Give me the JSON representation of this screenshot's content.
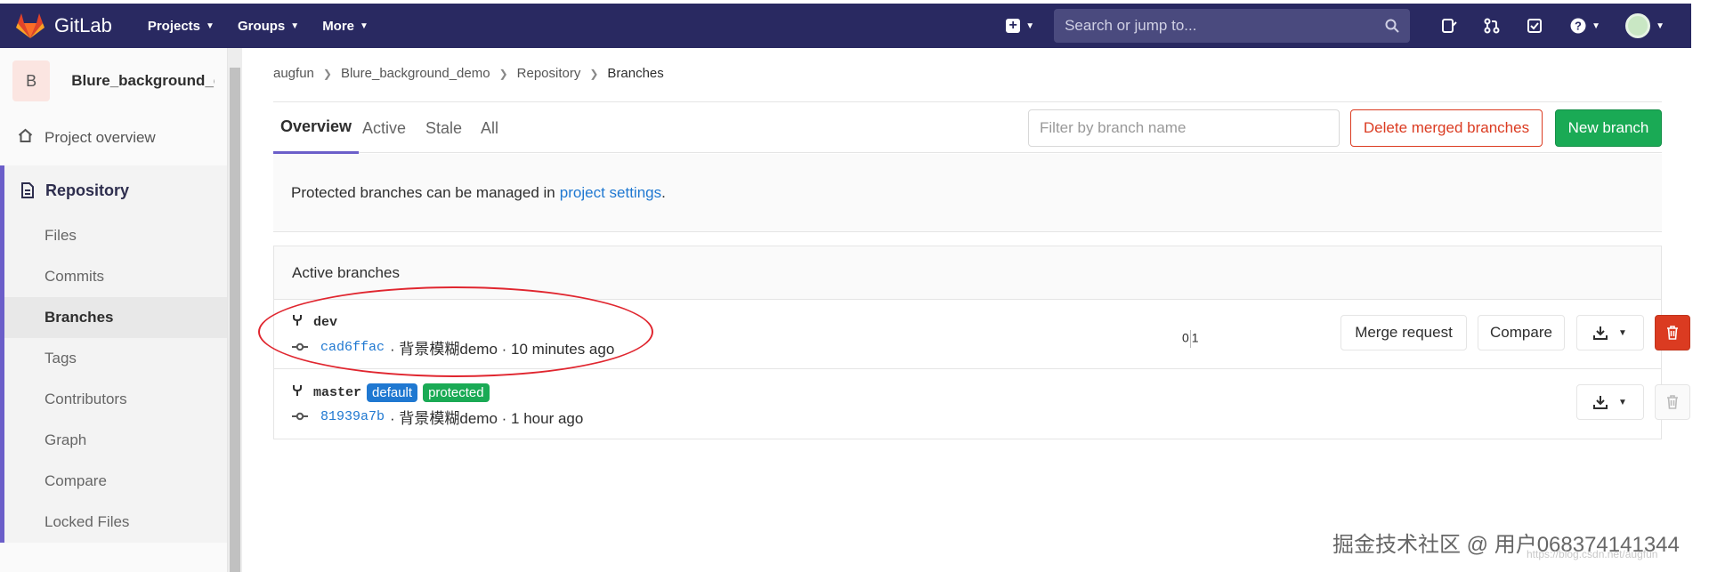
{
  "nav": {
    "brand": "GitLab",
    "links": [
      {
        "label": "Projects"
      },
      {
        "label": "Groups"
      },
      {
        "label": "More"
      }
    ],
    "search_placeholder": "Search or jump to..."
  },
  "sidebar": {
    "project_avatar_letter": "B",
    "project_name": "Blure_background_d...",
    "overview_label": "Project overview",
    "repository_label": "Repository",
    "sub_items": [
      {
        "label": "Files"
      },
      {
        "label": "Commits"
      },
      {
        "label": "Branches"
      },
      {
        "label": "Tags"
      },
      {
        "label": "Contributors"
      },
      {
        "label": "Graph"
      },
      {
        "label": "Compare"
      },
      {
        "label": "Locked Files"
      }
    ]
  },
  "breadcrumb": [
    "augfun",
    "Blure_background_demo",
    "Repository",
    "Branches"
  ],
  "tabs": [
    {
      "label": "Overview"
    },
    {
      "label": "Active"
    },
    {
      "label": "Stale"
    },
    {
      "label": "All"
    }
  ],
  "filter_placeholder": "Filter by branch name",
  "delete_merged_label": "Delete merged branches",
  "new_branch_label": "New branch",
  "notice": {
    "text": "Protected branches can be managed in",
    "link": "project settings",
    "end": "."
  },
  "active_branches_title": "Active branches",
  "branches": [
    {
      "name": "dev",
      "sha": "cad6ffac",
      "commit_text": "· 背景模糊demo · 10 minutes ago",
      "behind": "0",
      "ahead": "1",
      "merge_request_label": "Merge request",
      "compare_label": "Compare"
    },
    {
      "name": "master",
      "badge_default": "default",
      "badge_protected": "protected",
      "sha": "81939a7b",
      "commit_text": "· 背景模糊demo · 1 hour ago"
    }
  ],
  "watermark": "掘金技术社区 @ 用户068374141344",
  "watermark_url": "https://blog.csdn.net/augfun",
  "colors": {
    "nav_bg": "#292961",
    "accent": "#6b5ec9",
    "link": "#1f78d1",
    "success": "#1aaa55",
    "danger": "#db3b21",
    "annotation": "#e0262f"
  }
}
